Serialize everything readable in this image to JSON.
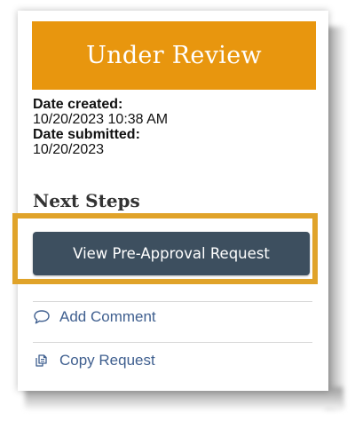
{
  "status": {
    "title": "Under Review",
    "color": "#e8960e"
  },
  "meta": {
    "created_label": "Date created:",
    "created_value": "10/20/2023 10:38 AM",
    "submitted_label": "Date submitted:",
    "submitted_value": "10/20/2023"
  },
  "next_steps": {
    "heading": "Next Steps",
    "primary_button_label": "View Pre-Approval Request",
    "highlight_color": "#e0a32a",
    "button_color": "#3d4f5f"
  },
  "actions": {
    "add_comment": {
      "label": "Add Comment",
      "icon": "speech-bubble-icon"
    },
    "copy_request": {
      "label": "Copy Request",
      "icon": "copy-icon"
    }
  }
}
